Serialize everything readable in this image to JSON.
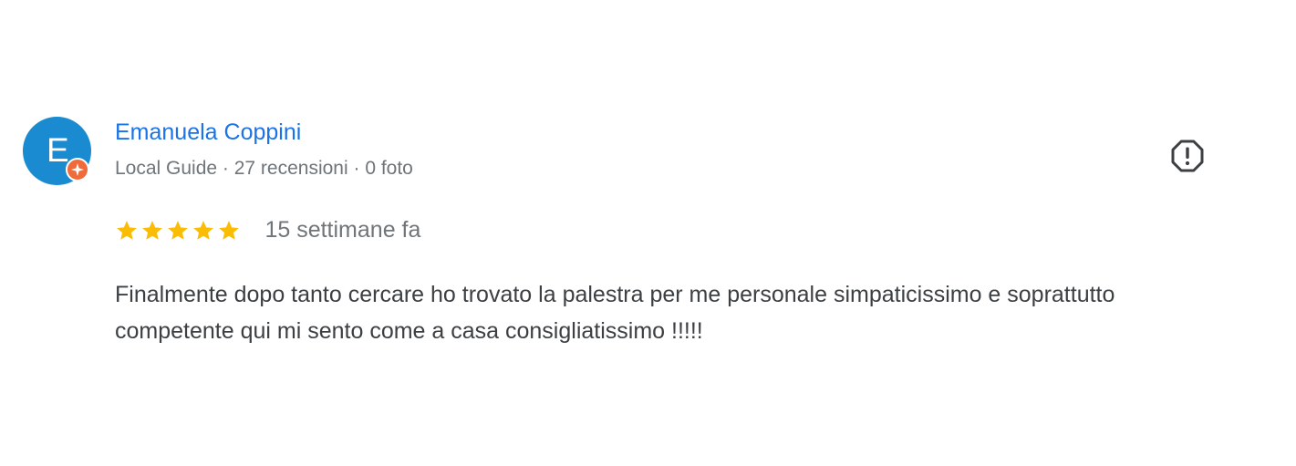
{
  "review": {
    "avatar": {
      "initial": "E",
      "color": "#1a8bd1",
      "badge_color": "#f06a3a",
      "badge_icon": "local-guide-star-icon"
    },
    "reviewer": {
      "name": "Emanuela Coppini",
      "meta": "Local Guide · 27 recensioni · 0 foto",
      "name_color": "#1a73e8"
    },
    "rating": {
      "value": 5,
      "max": 5,
      "star_color": "#fbbc04"
    },
    "date": "15 settimane fa",
    "text": "Finalmente dopo tanto cercare ho trovato la palestra per me personale simpaticissimo e soprattutto competente qui mi sento come a casa consigliatissimo !!!!!",
    "report_icon": "report-review-icon"
  }
}
